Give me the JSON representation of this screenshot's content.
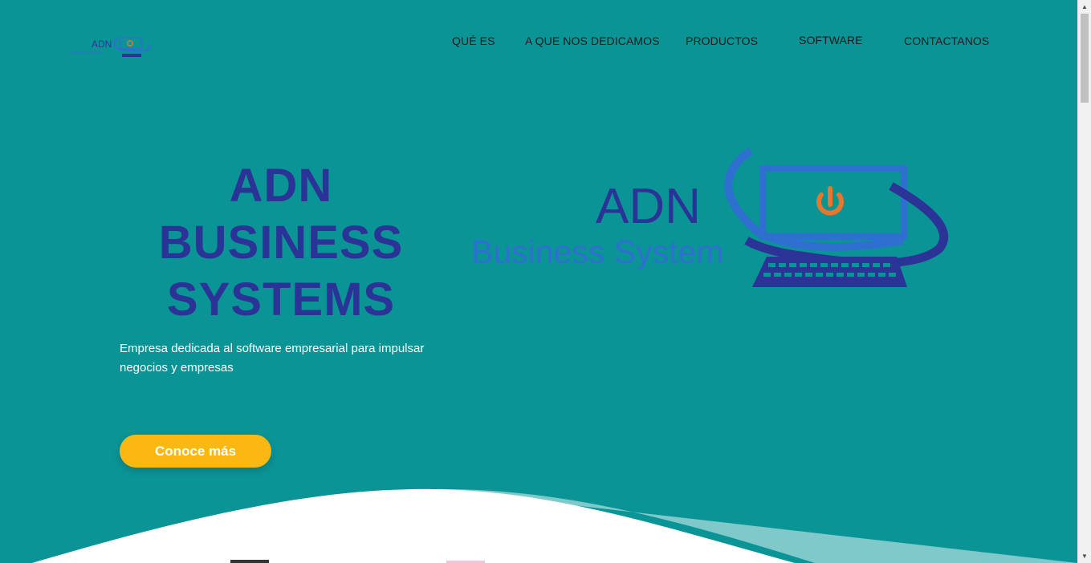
{
  "brand": {
    "logo_word": "ADN",
    "logo_tagline": "Business System"
  },
  "nav": {
    "items": [
      {
        "label": "QUÉ ES"
      },
      {
        "label": "A QUE NOS DEDICAMOS"
      },
      {
        "label": "PRODUCTOS"
      },
      {
        "label": "SOFTWARE"
      },
      {
        "label": "CONTACTANOS"
      }
    ]
  },
  "hero": {
    "title_lines": [
      "ADN",
      "BUSINESS",
      "SYSTEMS"
    ],
    "description": "Empresa dedicada al software empresarial para impulsar negocios y empresas",
    "cta_label": "Conoce más"
  },
  "colors": {
    "background": "#0b9496",
    "title": "#2b3397",
    "cta": "#fbb812",
    "logo_blue": "#2b3397",
    "logo_light_blue": "#2f6fd0",
    "power_orange": "#e8772e"
  },
  "icons": {
    "hero_logo": "computer-monitor-power-icon",
    "small_logo": "adn-logo-icon"
  }
}
